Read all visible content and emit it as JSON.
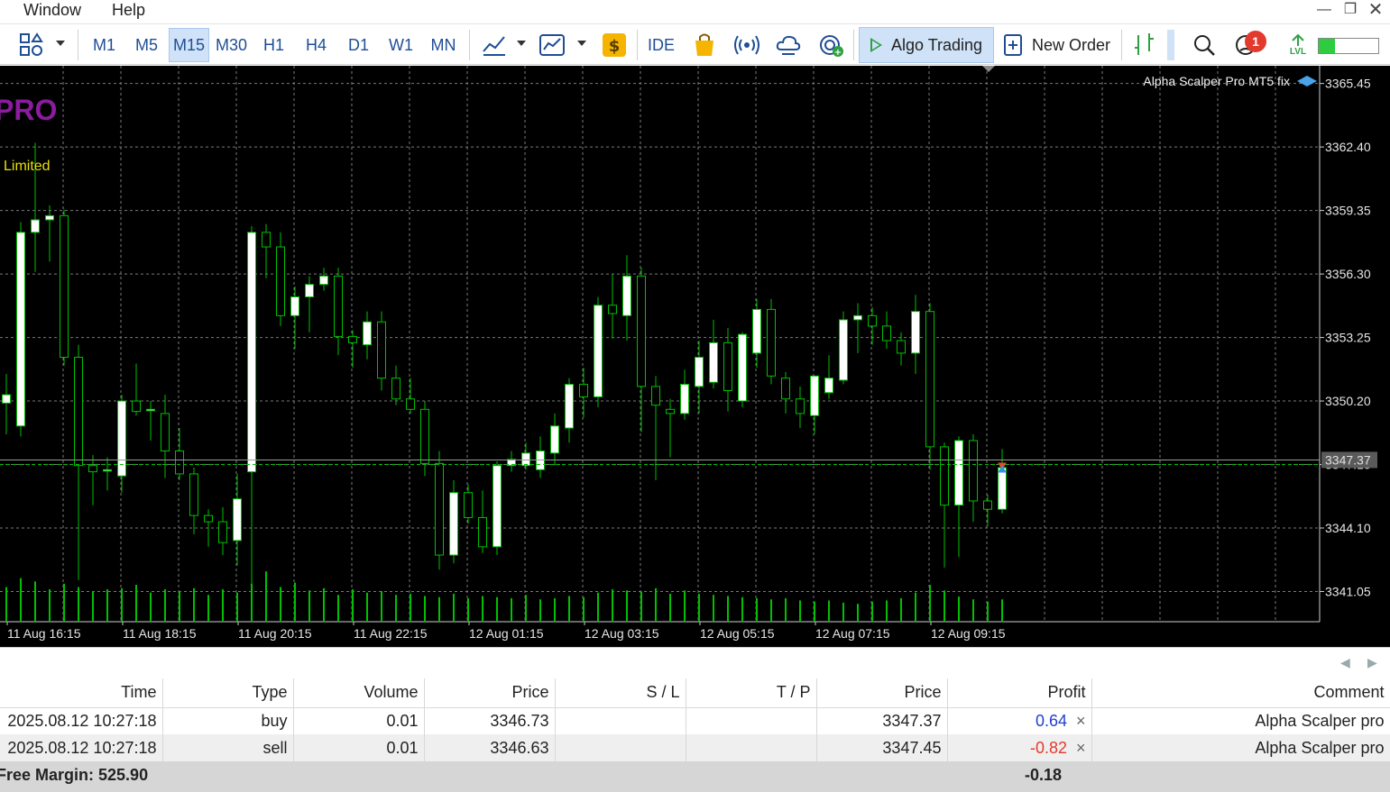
{
  "menu": {
    "items": [
      "Window",
      "Help"
    ]
  },
  "window_controls": [
    "minimize-icon",
    "restore-icon",
    "close-icon"
  ],
  "toolbar": {
    "timeframes": [
      "M1",
      "M5",
      "M15",
      "M30",
      "H1",
      "H4",
      "D1",
      "W1",
      "MN"
    ],
    "active_timeframe": "M15",
    "ide_label": "IDE",
    "algo_trading_label": "Algo Trading",
    "new_order_label": "New Order",
    "notification_count": "1",
    "level_label": "LVL",
    "level_fill": 0.28,
    "icons": [
      "objects-icon",
      "indicator-line-icon",
      "chart-template-icon",
      "dollar-icon",
      "market-bag-icon",
      "signals-icon",
      "vps-cloud-icon",
      "economic-calendar-icon",
      "algo-trading-play-icon",
      "new-order-plus-icon",
      "depth-of-market-icon",
      "search-icon",
      "notifications-icon",
      "signal-level-icon"
    ]
  },
  "chart": {
    "expert_label": "Alpha Scalper Pro MT5 fix",
    "overlay_title": "PRO",
    "overlay_status": "Limited",
    "current_price_label": "3347.37",
    "colors": {
      "bull_fill": "#ffffff",
      "bear_fill": "#000000",
      "wick": "#00c000",
      "grid": "#7a7a7a",
      "volume": "#00c000",
      "title": "#8b1c9e",
      "status": "#e8e000",
      "bid_line": "#00c000"
    },
    "time_labels": [
      "11 Aug 16:15",
      "11 Aug 18:15",
      "11 Aug 20:15",
      "11 Aug 22:15",
      "12 Aug 01:15",
      "12 Aug 03:15",
      "12 Aug 05:15",
      "12 Aug 07:15",
      "12 Aug 09:15"
    ]
  },
  "chart_data": {
    "type": "candlestick",
    "ylim": [
      3339.6,
      3366.3
    ],
    "y_ticks": [
      "3365.45",
      "3362.40",
      "3359.35",
      "3356.30",
      "3353.25",
      "3350.20",
      "3347.15",
      "3344.10",
      "3341.05"
    ],
    "bid_price": 3347.15,
    "ask_price": 3347.37,
    "candles": [
      {
        "o": 3350.1,
        "h": 3351.5,
        "l": 3348.6,
        "c": 3350.5
      },
      {
        "o": 3349.0,
        "h": 3358.8,
        "l": 3348.5,
        "c": 3358.3
      },
      {
        "o": 3358.3,
        "h": 3362.6,
        "l": 3356.4,
        "c": 3358.9
      },
      {
        "o": 3358.9,
        "h": 3359.6,
        "l": 3356.9,
        "c": 3359.1
      },
      {
        "o": 3359.1,
        "h": 3359.4,
        "l": 3351.9,
        "c": 3352.3
      },
      {
        "o": 3352.3,
        "h": 3352.9,
        "l": 3341.6,
        "c": 3347.1
      },
      {
        "o": 3347.1,
        "h": 3347.6,
        "l": 3345.2,
        "c": 3346.8
      },
      {
        "o": 3346.9,
        "h": 3347.5,
        "l": 3345.9,
        "c": 3346.9
      },
      {
        "o": 3346.6,
        "h": 3350.5,
        "l": 3345.8,
        "c": 3350.2
      },
      {
        "o": 3350.2,
        "h": 3352.0,
        "l": 3349.5,
        "c": 3349.7
      },
      {
        "o": 3349.8,
        "h": 3350.2,
        "l": 3348.3,
        "c": 3349.8
      },
      {
        "o": 3349.6,
        "h": 3350.5,
        "l": 3346.5,
        "c": 3347.8
      },
      {
        "o": 3347.8,
        "h": 3348.9,
        "l": 3346.4,
        "c": 3346.7
      },
      {
        "o": 3346.7,
        "h": 3347.0,
        "l": 3343.8,
        "c": 3344.7
      },
      {
        "o": 3344.7,
        "h": 3345.0,
        "l": 3343.2,
        "c": 3344.4
      },
      {
        "o": 3344.4,
        "h": 3345.1,
        "l": 3342.8,
        "c": 3343.4
      },
      {
        "o": 3343.5,
        "h": 3346.7,
        "l": 3342.3,
        "c": 3345.5
      },
      {
        "o": 3346.8,
        "h": 3358.6,
        "l": 3341.2,
        "c": 3358.3
      },
      {
        "o": 3358.3,
        "h": 3358.7,
        "l": 3356.1,
        "c": 3357.6
      },
      {
        "o": 3357.6,
        "h": 3358.3,
        "l": 3353.8,
        "c": 3354.3
      },
      {
        "o": 3354.3,
        "h": 3355.7,
        "l": 3352.7,
        "c": 3355.2
      },
      {
        "o": 3355.2,
        "h": 3356.2,
        "l": 3353.5,
        "c": 3355.8
      },
      {
        "o": 3355.8,
        "h": 3356.6,
        "l": 3355.5,
        "c": 3356.2
      },
      {
        "o": 3356.2,
        "h": 3356.6,
        "l": 3352.4,
        "c": 3353.3
      },
      {
        "o": 3353.3,
        "h": 3353.6,
        "l": 3351.8,
        "c": 3353.0
      },
      {
        "o": 3352.9,
        "h": 3354.5,
        "l": 3352.2,
        "c": 3354.0
      },
      {
        "o": 3354.0,
        "h": 3354.5,
        "l": 3350.7,
        "c": 3351.3
      },
      {
        "o": 3351.3,
        "h": 3351.9,
        "l": 3350.0,
        "c": 3350.3
      },
      {
        "o": 3350.3,
        "h": 3351.3,
        "l": 3349.6,
        "c": 3349.8
      },
      {
        "o": 3349.8,
        "h": 3350.2,
        "l": 3346.6,
        "c": 3347.2
      },
      {
        "o": 3347.2,
        "h": 3347.8,
        "l": 3342.1,
        "c": 3342.8
      },
      {
        "o": 3342.8,
        "h": 3346.4,
        "l": 3342.4,
        "c": 3345.8
      },
      {
        "o": 3345.8,
        "h": 3346.2,
        "l": 3344.3,
        "c": 3344.6
      },
      {
        "o": 3344.6,
        "h": 3345.9,
        "l": 3342.9,
        "c": 3343.2
      },
      {
        "o": 3343.2,
        "h": 3347.3,
        "l": 3342.8,
        "c": 3347.1
      },
      {
        "o": 3347.1,
        "h": 3347.8,
        "l": 3346.8,
        "c": 3347.4
      },
      {
        "o": 3347.1,
        "h": 3348.2,
        "l": 3346.9,
        "c": 3347.7
      },
      {
        "o": 3346.9,
        "h": 3348.5,
        "l": 3346.5,
        "c": 3347.8
      },
      {
        "o": 3347.7,
        "h": 3349.6,
        "l": 3347.1,
        "c": 3349.0
      },
      {
        "o": 3348.9,
        "h": 3351.3,
        "l": 3348.2,
        "c": 3351.0
      },
      {
        "o": 3351.0,
        "h": 3351.8,
        "l": 3349.4,
        "c": 3350.4
      },
      {
        "o": 3350.4,
        "h": 3355.2,
        "l": 3349.9,
        "c": 3354.8
      },
      {
        "o": 3354.8,
        "h": 3356.3,
        "l": 3353.2,
        "c": 3354.4
      },
      {
        "o": 3354.3,
        "h": 3357.2,
        "l": 3353.1,
        "c": 3356.2
      },
      {
        "o": 3356.2,
        "h": 3356.6,
        "l": 3348.7,
        "c": 3350.9
      },
      {
        "o": 3350.9,
        "h": 3351.4,
        "l": 3346.4,
        "c": 3350.0
      },
      {
        "o": 3349.8,
        "h": 3350.3,
        "l": 3347.5,
        "c": 3349.6
      },
      {
        "o": 3349.6,
        "h": 3351.7,
        "l": 3349.3,
        "c": 3351.0
      },
      {
        "o": 3350.9,
        "h": 3353.1,
        "l": 3349.6,
        "c": 3352.3
      },
      {
        "o": 3351.1,
        "h": 3354.1,
        "l": 3350.8,
        "c": 3353.0
      },
      {
        "o": 3353.0,
        "h": 3353.7,
        "l": 3349.7,
        "c": 3350.7
      },
      {
        "o": 3350.2,
        "h": 3353.5,
        "l": 3349.9,
        "c": 3353.4
      },
      {
        "o": 3352.5,
        "h": 3355.1,
        "l": 3351.8,
        "c": 3354.6
      },
      {
        "o": 3354.6,
        "h": 3355.1,
        "l": 3351.0,
        "c": 3351.4
      },
      {
        "o": 3351.3,
        "h": 3351.6,
        "l": 3349.6,
        "c": 3350.3
      },
      {
        "o": 3350.3,
        "h": 3350.9,
        "l": 3348.9,
        "c": 3349.6
      },
      {
        "o": 3349.5,
        "h": 3351.1,
        "l": 3348.6,
        "c": 3351.4
      },
      {
        "o": 3350.6,
        "h": 3352.4,
        "l": 3350.3,
        "c": 3351.3
      },
      {
        "o": 3351.2,
        "h": 3354.5,
        "l": 3351.0,
        "c": 3354.1
      },
      {
        "o": 3354.1,
        "h": 3354.9,
        "l": 3352.5,
        "c": 3354.3
      },
      {
        "o": 3354.3,
        "h": 3354.7,
        "l": 3352.9,
        "c": 3353.8
      },
      {
        "o": 3353.8,
        "h": 3354.5,
        "l": 3352.7,
        "c": 3353.1
      },
      {
        "o": 3353.1,
        "h": 3353.5,
        "l": 3351.9,
        "c": 3352.5
      },
      {
        "o": 3352.5,
        "h": 3355.3,
        "l": 3351.5,
        "c": 3354.5
      },
      {
        "o": 3354.5,
        "h": 3354.9,
        "l": 3346.9,
        "c": 3348.0
      },
      {
        "o": 3348.0,
        "h": 3348.2,
        "l": 3342.2,
        "c": 3345.2
      },
      {
        "o": 3345.2,
        "h": 3348.5,
        "l": 3342.7,
        "c": 3348.3
      },
      {
        "o": 3348.3,
        "h": 3348.6,
        "l": 3344.4,
        "c": 3345.4
      },
      {
        "o": 3345.4,
        "h": 3345.7,
        "l": 3344.2,
        "c": 3345.0
      },
      {
        "o": 3345.0,
        "h": 3347.9,
        "l": 3344.8,
        "c": 3347.0
      }
    ],
    "volumes": [
      0.62,
      0.78,
      0.72,
      0.58,
      0.68,
      0.62,
      0.55,
      0.58,
      0.6,
      0.66,
      0.52,
      0.58,
      0.55,
      0.6,
      0.48,
      0.58,
      0.52,
      0.68,
      0.9,
      0.62,
      0.7,
      0.56,
      0.6,
      0.48,
      0.58,
      0.52,
      0.55,
      0.48,
      0.5,
      0.46,
      0.44,
      0.5,
      0.42,
      0.46,
      0.44,
      0.42,
      0.48,
      0.4,
      0.42,
      0.46,
      0.44,
      0.52,
      0.58,
      0.56,
      0.54,
      0.6,
      0.5,
      0.56,
      0.5,
      0.48,
      0.46,
      0.44,
      0.42,
      0.4,
      0.42,
      0.38,
      0.36,
      0.38,
      0.34,
      0.32,
      0.36,
      0.38,
      0.42,
      0.52,
      0.66,
      0.56,
      0.45,
      0.4,
      0.36,
      0.4
    ]
  },
  "positions_table": {
    "columns": [
      "Time",
      "Type",
      "Volume",
      "Price",
      "S / L",
      "T / P",
      "Price",
      "Profit",
      "Comment"
    ],
    "rows": [
      {
        "time": "2025.08.12 10:27:18",
        "type": "buy",
        "volume": "0.01",
        "price": "3346.73",
        "sl": "",
        "tp": "",
        "current_price": "3347.37",
        "profit": "0.64",
        "comment": "Alpha Scalper pro"
      },
      {
        "time": "2025.08.12 10:27:18",
        "type": "sell",
        "volume": "0.01",
        "price": "3346.63",
        "sl": "",
        "tp": "",
        "current_price": "3347.45",
        "profit": "-0.82",
        "comment": "Alpha Scalper pro"
      }
    ],
    "close_glyph": "×"
  },
  "summary": {
    "free_margin_text": "Free Margin: 525.90",
    "total_profit": "-0.18"
  }
}
